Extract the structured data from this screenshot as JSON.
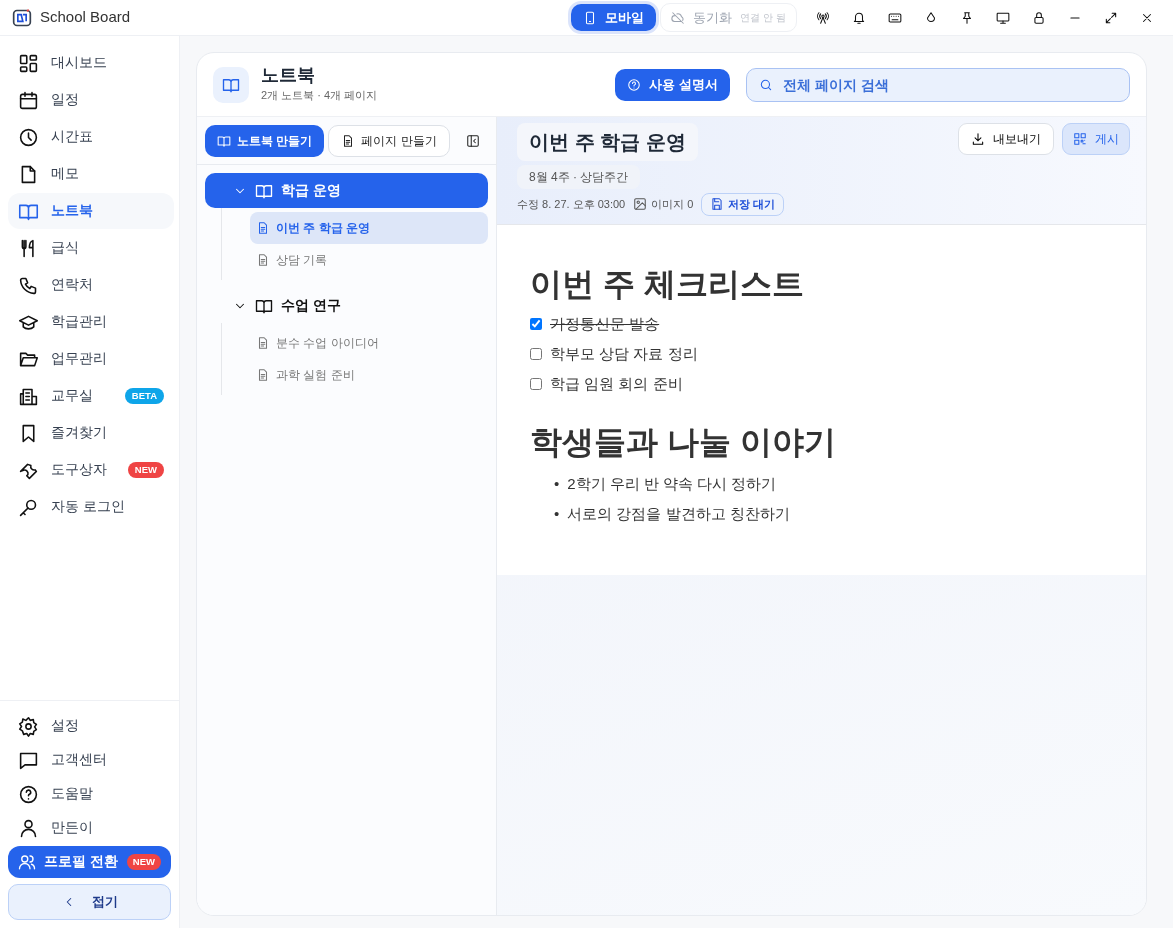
{
  "window": {
    "title": "School Board",
    "mobile_button": "모바일",
    "sync": {
      "label": "동기화",
      "status": "연결 안 됨",
      "connected": false
    }
  },
  "sidebar": {
    "items": [
      {
        "label": "대시보드",
        "selected": false
      },
      {
        "label": "일정",
        "selected": false
      },
      {
        "label": "시간표",
        "selected": false
      },
      {
        "label": "메모",
        "selected": false
      },
      {
        "label": "노트북",
        "selected": true
      },
      {
        "label": "급식",
        "selected": false
      },
      {
        "label": "연락처",
        "selected": false
      },
      {
        "label": "학급관리",
        "selected": false
      },
      {
        "label": "업무관리",
        "selected": false
      },
      {
        "label": "교무실",
        "selected": false,
        "badge": {
          "text": "BETA",
          "color": "#0ea5e9"
        }
      },
      {
        "label": "즐겨찾기",
        "selected": false
      },
      {
        "label": "도구상자",
        "selected": false,
        "badge": {
          "text": "NEW",
          "color": "#ef4444"
        }
      },
      {
        "label": "자동 로그인",
        "selected": false
      }
    ],
    "footer_items": [
      {
        "label": "설정"
      },
      {
        "label": "고객센터"
      },
      {
        "label": "도움말"
      },
      {
        "label": "만든이"
      }
    ],
    "profile_button": {
      "label": "프로필 전환",
      "badge": "NEW"
    },
    "collapse_button": "접기"
  },
  "notebook": {
    "title": "노트북",
    "subtitle": "2개 노트북 · 4개 페이지",
    "guide_button": "사용 설명서",
    "search": {
      "placeholder": "전체 페이지 검색"
    },
    "new_notebook_button": "노트북 만들기",
    "new_page_button": "페이지 만들기",
    "tree": [
      {
        "label": "학급 운영",
        "expanded": true,
        "selected": true,
        "children": [
          {
            "label": "이번 주 학급 운영",
            "selected": true
          },
          {
            "label": "상담 기록",
            "selected": false
          }
        ]
      },
      {
        "label": "수업 연구",
        "expanded": true,
        "selected": false,
        "children": [
          {
            "label": "분수 수업 아이디어",
            "selected": false
          },
          {
            "label": "과학 실험 준비",
            "selected": false
          }
        ]
      }
    ]
  },
  "page": {
    "title": "이번 주 학급 운영",
    "subtitle": "8월 4주 · 상담주간",
    "modified": "수정 8. 27. 오후 03:00",
    "images": "이미지 0",
    "save_status": "저장 대기",
    "export_button": "내보내기",
    "publish_button": "게시",
    "blocks": [
      {
        "kind": "heading",
        "text": "이번 주 체크리스트"
      },
      {
        "kind": "checklist",
        "items": [
          {
            "text": "가정통신문 발송",
            "checked": true
          },
          {
            "text": "학부모 상담 자료 정리",
            "checked": false
          },
          {
            "text": "학급 임원 회의 준비",
            "checked": false
          }
        ]
      },
      {
        "kind": "heading",
        "text": "학생들과 나눌 이야기"
      },
      {
        "kind": "bullets",
        "items": [
          {
            "marker": "•",
            "text": "2학기 우리 반 약속 다시 정하기"
          },
          {
            "marker": "•",
            "text": "서로의 강점을 발견하고 칭찬하기"
          }
        ]
      }
    ]
  }
}
